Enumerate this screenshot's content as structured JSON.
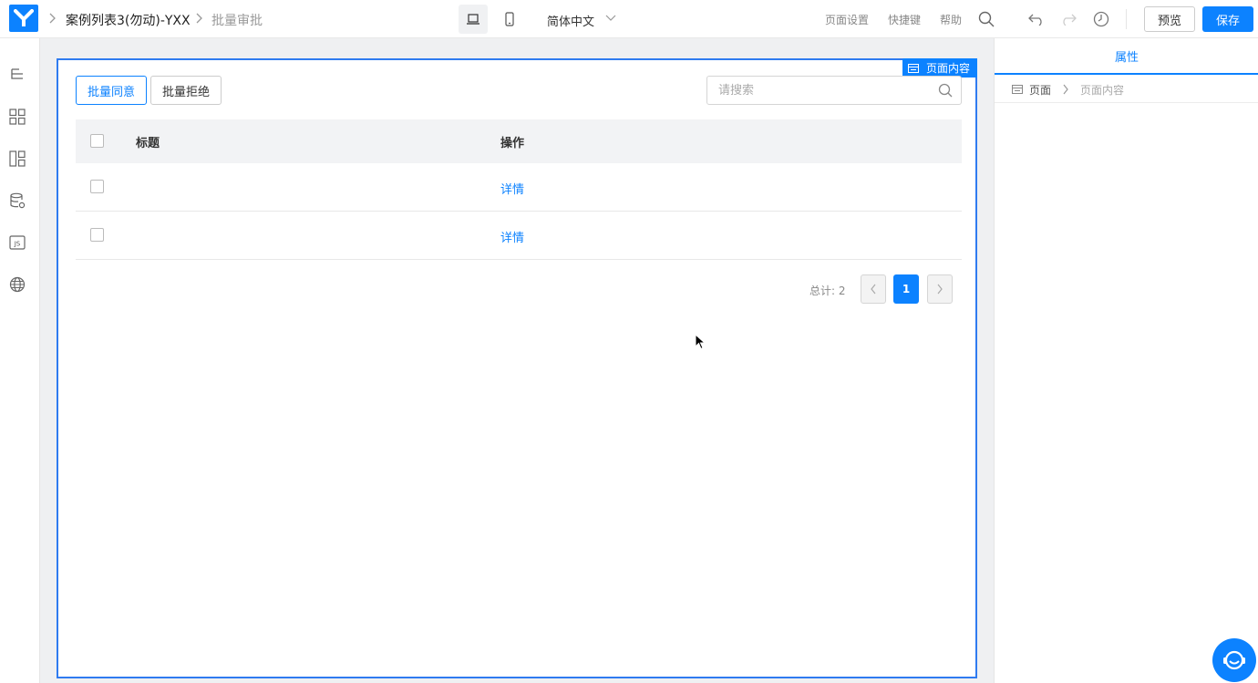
{
  "topbar": {
    "app_name": "案例列表3(勿动)-YXX",
    "page_name": "批量审批",
    "language": "简体中文",
    "links": [
      "页面设置",
      "快捷键",
      "帮助"
    ],
    "preview_label": "预览",
    "save_label": "保存"
  },
  "sidebar_icons": [
    "outline-tree-icon",
    "components-grid-icon",
    "layout-icon",
    "datasource-icon",
    "js-icon",
    "globe-icon"
  ],
  "canvas": {
    "tag_label": "页面内容",
    "approve_label": "批量同意",
    "reject_label": "批量拒绝",
    "search_placeholder": "请搜索",
    "table": {
      "headers": [
        "标题",
        "操作"
      ],
      "rows": [
        {
          "title": "",
          "action": "详情"
        },
        {
          "title": "",
          "action": "详情"
        }
      ]
    },
    "pagination": {
      "total_text": "总计: 2",
      "current_page": "1"
    }
  },
  "right_panel": {
    "tab_label": "属性",
    "crumb_root": "页面",
    "crumb_current": "页面内容"
  },
  "colors": {
    "accent": "#0c82ff",
    "canvas_bg": "#eff0f2",
    "selection_border": "#2f7bf0"
  }
}
